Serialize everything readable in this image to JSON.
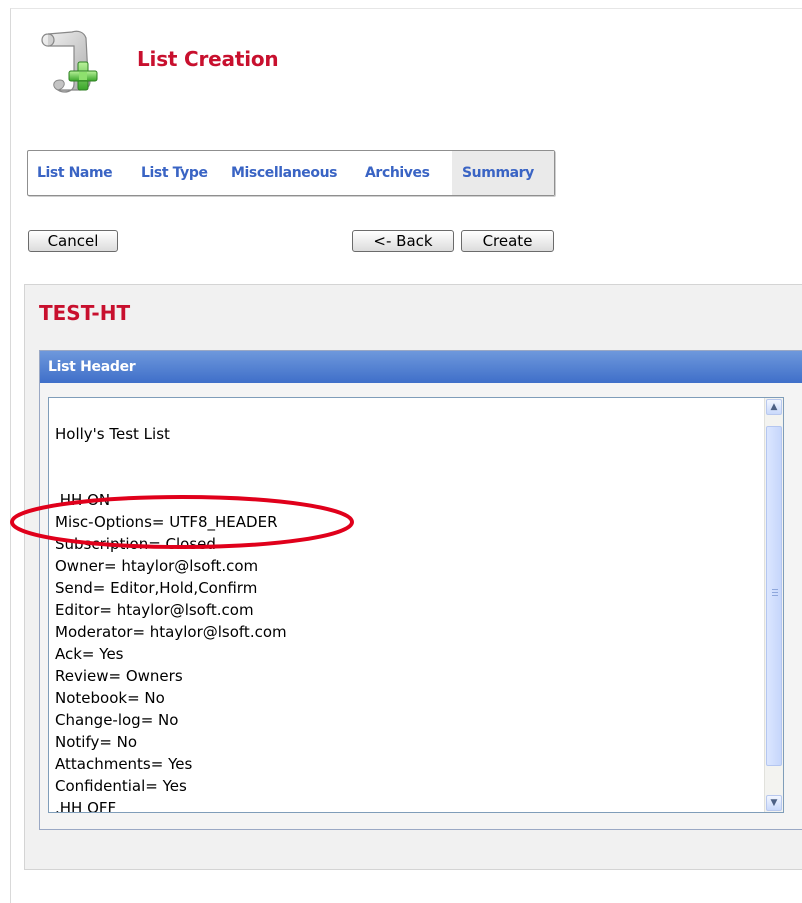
{
  "header": {
    "title": "List Creation",
    "icon": "scroll-add-icon"
  },
  "tabs": [
    {
      "label": "List Name",
      "active": false
    },
    {
      "label": "List Type",
      "active": false
    },
    {
      "label": "Miscellaneous",
      "active": false
    },
    {
      "label": "Archives",
      "active": false
    },
    {
      "label": "Summary",
      "active": true
    }
  ],
  "buttons": {
    "cancel": "Cancel",
    "back": "<- Back",
    "create": "Create"
  },
  "list_name": "TEST-HT",
  "list_header": {
    "heading": "List Header",
    "lines": [
      "Holly's Test List",
      "",
      "",
      ".HH ON",
      "Misc-Options= UTF8_HEADER",
      "Subscription= Closed",
      "Owner= htaylor@lsoft.com",
      "Send= Editor,Hold,Confirm",
      "Editor= htaylor@lsoft.com",
      "Moderator= htaylor@lsoft.com",
      "Ack= Yes",
      "Review= Owners",
      "Notebook= No",
      "Change-log= No",
      "Notify= No",
      "Attachments= Yes",
      "Confidential= Yes",
      ".HH OFF"
    ]
  },
  "colors": {
    "title_red": "#c8102e",
    "tab_blue": "#3a64c4",
    "header_bar_blue": "#4a78cf",
    "highlight_red": "#e0001b"
  }
}
